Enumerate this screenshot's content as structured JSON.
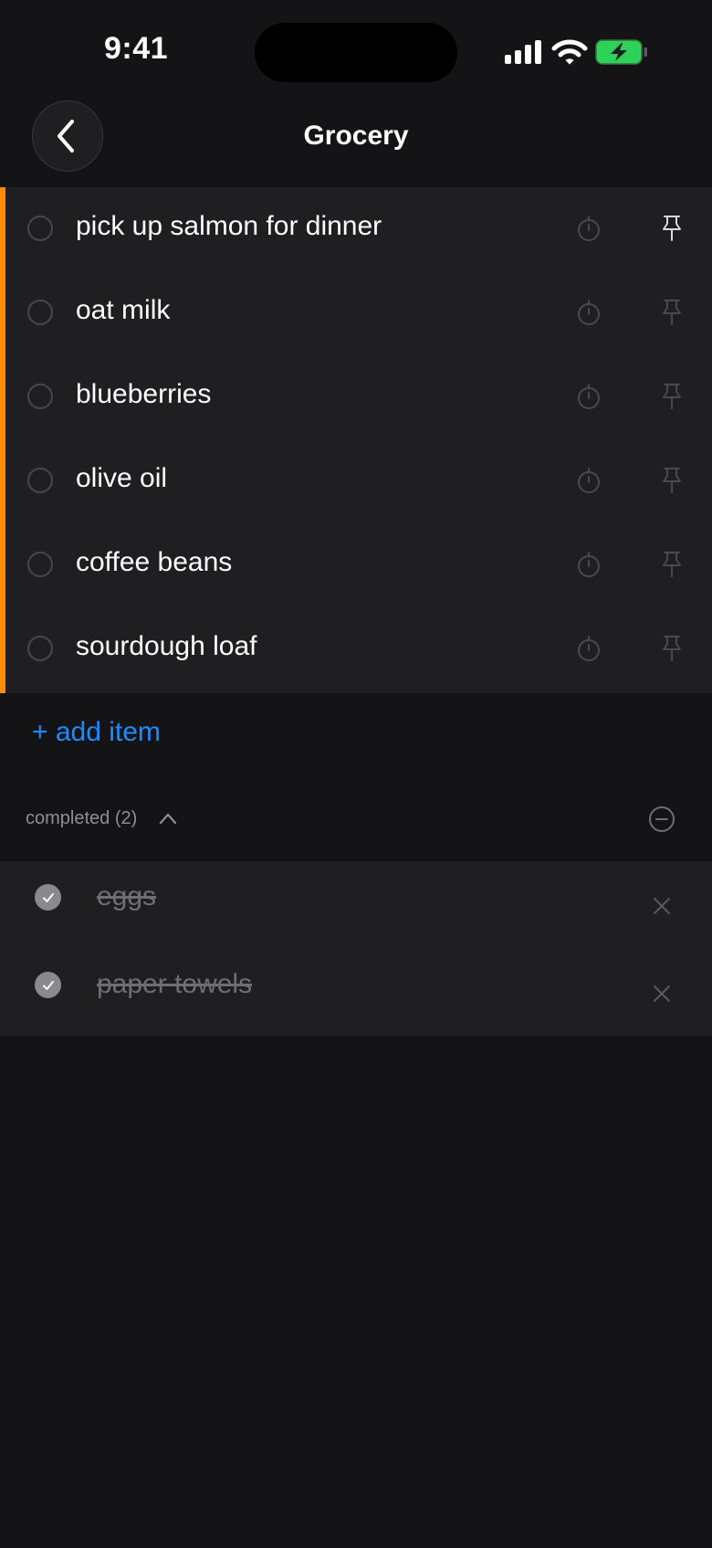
{
  "status_bar": {
    "time": "9:41"
  },
  "header": {
    "title": "Grocery"
  },
  "colors": {
    "accent": "#ff8a0c",
    "link": "#1a8cff",
    "background": "#141416",
    "row": "#1f1f22",
    "battery": "#30d158"
  },
  "icons": {
    "back": "chevron-left-icon",
    "timer": "timer-icon",
    "pin": "pin-icon",
    "collapse": "minus-circle-icon",
    "delete": "close-icon",
    "toggle": "chevron-up-icon"
  },
  "items": [
    {
      "label": "pick up salmon for dinner",
      "pinned": true
    },
    {
      "label": "oat milk",
      "pinned": false
    },
    {
      "label": "blueberries",
      "pinned": false
    },
    {
      "label": "olive oil",
      "pinned": false
    },
    {
      "label": "coffee beans",
      "pinned": false
    },
    {
      "label": "sourdough loaf",
      "pinned": false
    }
  ],
  "add_item_label": "+ add item",
  "completed": {
    "label": "completed (2)",
    "items": [
      {
        "label": "eggs"
      },
      {
        "label": "paper towels"
      }
    ]
  }
}
